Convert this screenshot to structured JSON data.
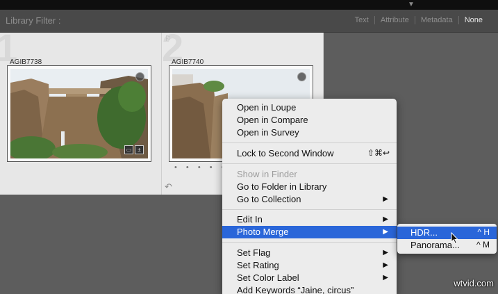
{
  "filter_bar": {
    "label": "Library Filter :",
    "options": [
      "Text",
      "Attribute",
      "Metadata",
      "None"
    ],
    "active": "None"
  },
  "grid": {
    "cells": [
      {
        "number": "1",
        "filename": "AGIB7738",
        "dots": "• • • • •"
      },
      {
        "number": "2",
        "filename": "AGIB7740",
        "dots": "• • • • •"
      }
    ]
  },
  "context_menu": {
    "items": [
      {
        "label": "Open in Loupe"
      },
      {
        "label": "Open in Compare"
      },
      {
        "label": "Open in Survey"
      },
      {
        "label": "Lock to Second Window",
        "shortcut": "⇧⌘↩"
      },
      {
        "label": "Show in Finder",
        "disabled": true
      },
      {
        "label": "Go to Folder in Library"
      },
      {
        "label": "Go to Collection",
        "submenu": true
      },
      {
        "label": "Edit In",
        "submenu": true
      },
      {
        "label": "Photo Merge",
        "submenu": true,
        "highlighted": true
      },
      {
        "label": "Set Flag",
        "submenu": true
      },
      {
        "label": "Set Rating",
        "submenu": true
      },
      {
        "label": "Set Color Label",
        "submenu": true
      },
      {
        "label": "Add Keywords “Jaine, circus”",
        "submenu": false
      }
    ]
  },
  "photo_merge_submenu": {
    "items": [
      {
        "label": "HDR...",
        "shortcut": "^ H",
        "highlighted": true
      },
      {
        "label": "Panorama...",
        "shortcut": "^ M"
      }
    ]
  },
  "watermark": "wtvid.com",
  "colors": {
    "menu_highlight": "#2a66d9",
    "panel_bg": "#5d5d5d",
    "cell_bg": "#e7e7e7"
  }
}
